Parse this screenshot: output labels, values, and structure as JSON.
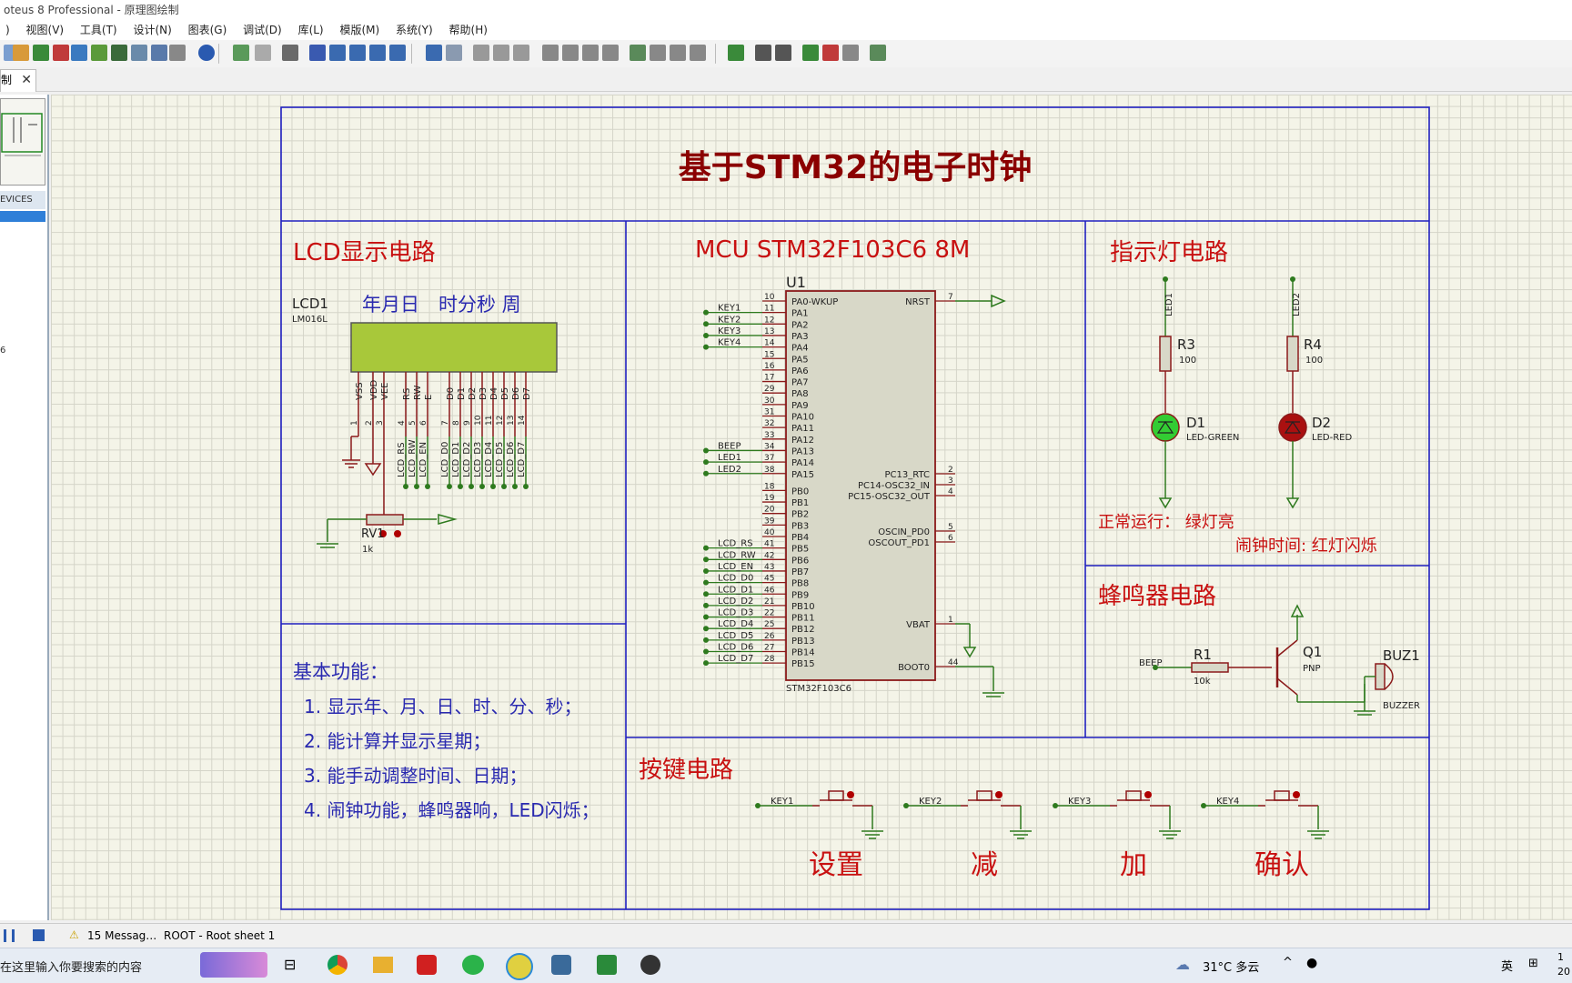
{
  "window": {
    "title": "oteus 8 Professional - 原理图绘制"
  },
  "menu": [
    "视图(V)",
    "工具(T)",
    "设计(N)",
    "图表(G)",
    "调试(D)",
    "库(L)",
    "模版(M)",
    "系统(Y)",
    "帮助(H)"
  ],
  "tab": {
    "label": "制",
    "close": "✕"
  },
  "left_panel": {
    "devices_header": "EVICES",
    "device_item": "6"
  },
  "schematic": {
    "title": "基于STM32的电子时钟",
    "lcd_section": "LCD显示电路",
    "lcd_ref": "LCD1",
    "lcd_part": "LM016L",
    "lcd_caption": "年月日　时分秒 周",
    "lcd_pins": [
      "VSS",
      "VDD",
      "VEE",
      "RS",
      "RW",
      "E",
      "D0",
      "D1",
      "D2",
      "D3",
      "D4",
      "D5",
      "D6",
      "D7"
    ],
    "lcd_pin_numbers": [
      "1",
      "2",
      "3",
      "4",
      "5",
      "6",
      "7",
      "8",
      "9",
      "10",
      "11",
      "12",
      "13",
      "14"
    ],
    "lcd_nets": [
      "LCD_RS",
      "LCD_RW",
      "LCD_EN",
      "LCD_D0",
      "LCD_D1",
      "LCD_D2",
      "LCD_D3",
      "LCD_D4",
      "LCD_D5",
      "LCD_D6",
      "LCD_D7"
    ],
    "rv1": {
      "ref": "RV1",
      "value": "1k"
    },
    "mcu_section": "MCU STM32F103C6 8M",
    "mcu_ref": "U1",
    "mcu_part": "STM32F103C6",
    "mcu_left_pins": [
      {
        "num": "10",
        "name": "PA0-WKUP",
        "net": ""
      },
      {
        "num": "11",
        "name": "PA1",
        "net": "KEY1"
      },
      {
        "num": "12",
        "name": "PA2",
        "net": "KEY2"
      },
      {
        "num": "13",
        "name": "PA3",
        "net": "KEY3"
      },
      {
        "num": "14",
        "name": "PA4",
        "net": "KEY4"
      },
      {
        "num": "15",
        "name": "PA5",
        "net": ""
      },
      {
        "num": "16",
        "name": "PA6",
        "net": ""
      },
      {
        "num": "17",
        "name": "PA7",
        "net": ""
      },
      {
        "num": "29",
        "name": "PA8",
        "net": ""
      },
      {
        "num": "30",
        "name": "PA9",
        "net": ""
      },
      {
        "num": "31",
        "name": "PA10",
        "net": ""
      },
      {
        "num": "32",
        "name": "PA11",
        "net": ""
      },
      {
        "num": "33",
        "name": "PA12",
        "net": ""
      },
      {
        "num": "34",
        "name": "PA13",
        "net": "BEEP"
      },
      {
        "num": "37",
        "name": "PA14",
        "net": "LED1"
      },
      {
        "num": "38",
        "name": "PA15",
        "net": "LED2"
      },
      {
        "num": "18",
        "name": "PB0",
        "net": ""
      },
      {
        "num": "19",
        "name": "PB1",
        "net": ""
      },
      {
        "num": "20",
        "name": "PB2",
        "net": ""
      },
      {
        "num": "39",
        "name": "PB3",
        "net": ""
      },
      {
        "num": "40",
        "name": "PB4",
        "net": ""
      },
      {
        "num": "41",
        "name": "PB5",
        "net": "LCD_RS"
      },
      {
        "num": "42",
        "name": "PB6",
        "net": "LCD_RW"
      },
      {
        "num": "43",
        "name": "PB7",
        "net": "LCD_EN"
      },
      {
        "num": "45",
        "name": "PB8",
        "net": "LCD_D0"
      },
      {
        "num": "46",
        "name": "PB9",
        "net": "LCD_D1"
      },
      {
        "num": "21",
        "name": "PB10",
        "net": "LCD_D2"
      },
      {
        "num": "22",
        "name": "PB11",
        "net": "LCD_D3"
      },
      {
        "num": "25",
        "name": "PB12",
        "net": "LCD_D4"
      },
      {
        "num": "26",
        "name": "PB13",
        "net": "LCD_D5"
      },
      {
        "num": "27",
        "name": "PB14",
        "net": "LCD_D6"
      },
      {
        "num": "28",
        "name": "PB15",
        "net": "LCD_D7"
      }
    ],
    "mcu_right_pins": [
      {
        "num": "7",
        "name": "NRST"
      },
      {
        "num": "2",
        "name": "PC13_RTC"
      },
      {
        "num": "3",
        "name": "PC14-OSC32_IN"
      },
      {
        "num": "4",
        "name": "PC15-OSC32_OUT"
      },
      {
        "num": "5",
        "name": "OSCIN_PD0"
      },
      {
        "num": "6",
        "name": "OSCOUT_PD1"
      },
      {
        "num": "1",
        "name": "VBAT"
      },
      {
        "num": "44",
        "name": "BOOT0"
      }
    ],
    "led_section": "指示灯电路",
    "led_nets": [
      "LED1",
      "LED2"
    ],
    "r3": {
      "ref": "R3",
      "value": "100"
    },
    "r4": {
      "ref": "R4",
      "value": "100"
    },
    "d1": {
      "ref": "D1",
      "part": "LED-GREEN"
    },
    "d2": {
      "ref": "D2",
      "part": "LED-RED"
    },
    "led_note1": "正常运行：  绿灯亮",
    "led_note2": "闹钟时间: 红灯闪烁",
    "buzzer_section": "蜂鸣器电路",
    "beep_net": "BEEP",
    "r1": {
      "ref": "R1",
      "value": "10k"
    },
    "q1": {
      "ref": "Q1",
      "part": "PNP"
    },
    "buz1": {
      "ref": "BUZ1",
      "part": "BUZZER"
    },
    "features_title": "基本功能：",
    "features": [
      "1. 显示年、月、日、时、分、秒；",
      "2. 能计算并显示星期；",
      "3. 能手动调整时间、日期；",
      "4. 闹钟功能，蜂鸣器响，LED闪烁；"
    ],
    "key_section": "按键电路",
    "keys": [
      {
        "net": "KEY1",
        "label": "设置"
      },
      {
        "net": "KEY2",
        "label": "减"
      },
      {
        "net": "KEY3",
        "label": "加"
      },
      {
        "net": "KEY4",
        "label": "确认"
      }
    ]
  },
  "status": {
    "messages": "15 Messag…",
    "sheet": "ROOT - Root sheet 1"
  },
  "taskbar": {
    "search": "在这里输入你要搜索的内容",
    "weather": "31°C 多云",
    "ime": "英",
    "clock": "1\n20"
  },
  "colors": {
    "wire": "#2e7a1e",
    "component": "#8b1a1a",
    "body_fill": "#d8d8c8",
    "text_red": "#c81010",
    "text_blue": "#2a2ab0",
    "frame": "#2020c0"
  }
}
